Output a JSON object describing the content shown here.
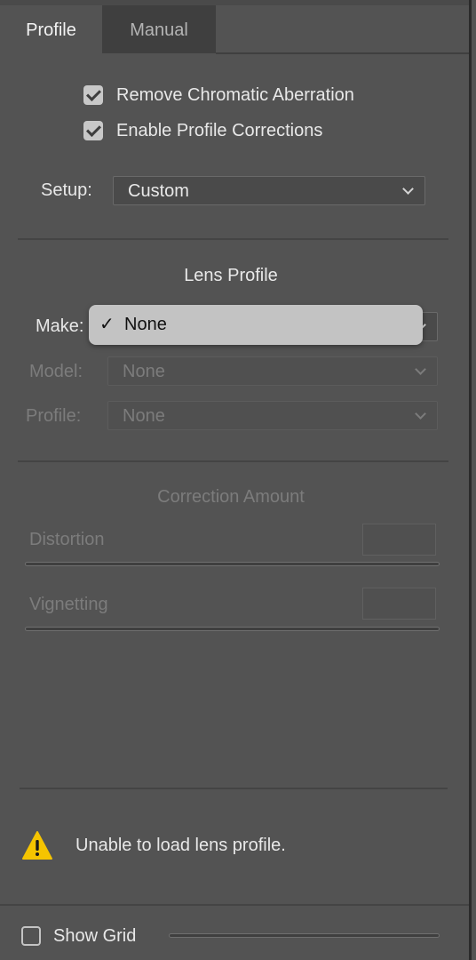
{
  "tabs": {
    "profile": "Profile",
    "manual": "Manual"
  },
  "options": {
    "remove_ca": {
      "label": "Remove Chromatic Aberration",
      "checked": true
    },
    "enable_profile": {
      "label": "Enable Profile Corrections",
      "checked": true
    }
  },
  "setup": {
    "label": "Setup:",
    "value": "Custom"
  },
  "lens_profile": {
    "title": "Lens Profile",
    "make_label": "Make:",
    "make_popup_option": "None",
    "make_popup_check": "✓",
    "model_label": "Model:",
    "model_value": "None",
    "profile_label": "Profile:",
    "profile_value": "None"
  },
  "correction": {
    "title": "Correction Amount",
    "distortion_label": "Distortion",
    "vignetting_label": "Vignetting"
  },
  "warning": {
    "icon": "warning-triangle-icon",
    "text": "Unable to load lens profile."
  },
  "footer": {
    "show_grid_label": "Show Grid",
    "show_grid_checked": false
  },
  "colors": {
    "panel_bg": "#535353",
    "inactive_tab_bg": "#3f3f3f",
    "popup_bg": "#c3c3c3",
    "warning_yellow": "#f5c400"
  }
}
